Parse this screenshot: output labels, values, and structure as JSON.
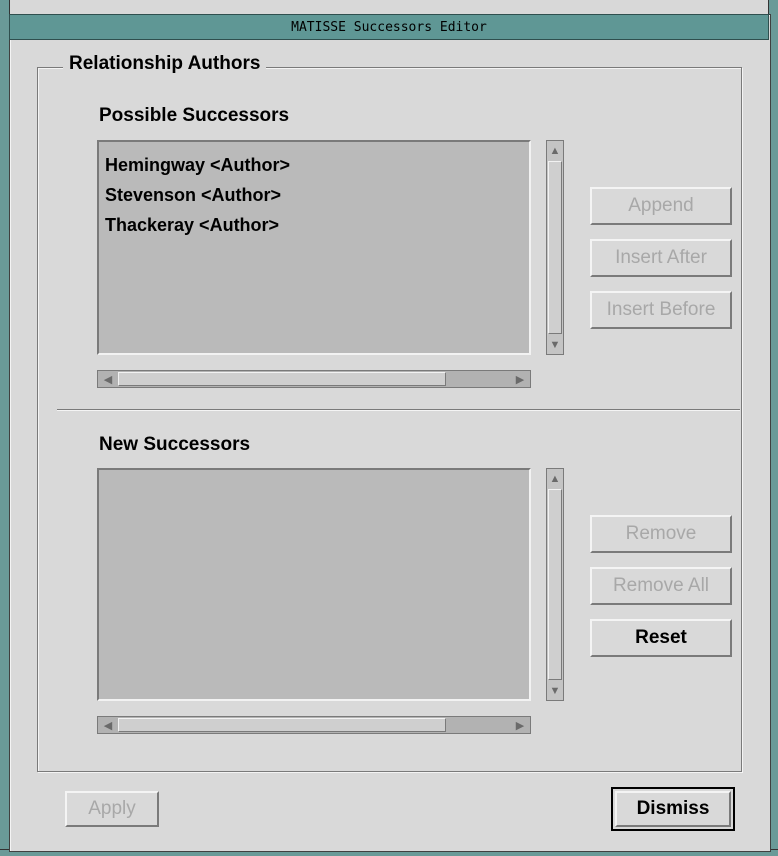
{
  "window": {
    "title": "MATISSE Successors Editor"
  },
  "group": {
    "title": "Relationship Authors"
  },
  "possible": {
    "label": "Possible Successors",
    "items": [
      "Hemingway <Author>",
      "Stevenson <Author>",
      "Thackeray <Author>"
    ]
  },
  "new": {
    "label": "New Successors",
    "items": []
  },
  "buttons": {
    "append": "Append",
    "insert_after": "Insert After",
    "insert_before": "Insert Before",
    "remove": "Remove",
    "remove_all": "Remove All",
    "reset": "Reset",
    "apply": "Apply",
    "dismiss": "Dismiss"
  },
  "icons": {
    "up": "▲",
    "down": "▼",
    "left": "◀",
    "right": "▶"
  }
}
